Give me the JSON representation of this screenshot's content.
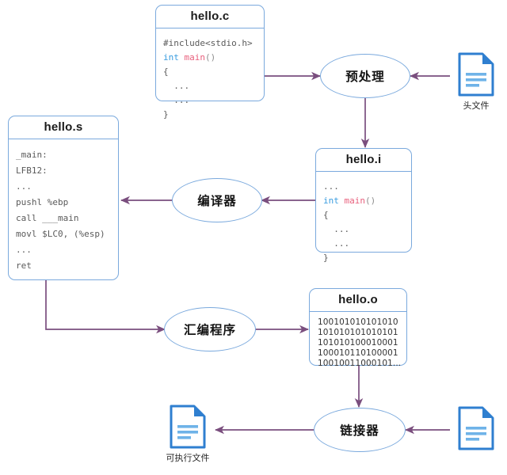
{
  "diagram": {
    "title": "C compilation pipeline",
    "colors": {
      "box_border": "#7aa9dd",
      "arrow": "#7a4e7e",
      "icon_blue": "#2f7fd0",
      "keyword_blue": "#3a9de0",
      "keyword_red": "#e8607d",
      "background": "#ffffff"
    },
    "files": {
      "hello_c": {
        "title": "hello.c",
        "lines": [
          "#include<stdio.h>",
          "int main()",
          "{",
          "  ...",
          "  ...",
          "}"
        ]
      },
      "hello_i": {
        "title": "hello.i",
        "lines": [
          "...",
          "int main()",
          "{",
          "  ...",
          "  ...",
          "}"
        ]
      },
      "hello_s": {
        "title": "hello.s",
        "lines": [
          "_main:",
          "LFB12:",
          "...",
          "pushl %ebp",
          "call ___main",
          "movl $LC0, (%esp)",
          "...",
          "ret"
        ]
      },
      "hello_o": {
        "title": "hello.o",
        "lines": [
          "100101010101010",
          "101010101010101",
          "101010100010001",
          "100010110100001",
          "10010011000101..."
        ]
      }
    },
    "processes": {
      "preprocess": "预处理",
      "compiler": "编译器",
      "assembler": "汇编程序",
      "linker": "链接器"
    },
    "icons": {
      "header_file": {
        "label": "头文件",
        "icon": "document-icon"
      },
      "executable_file": {
        "label": "可执行文件",
        "icon": "document-icon"
      },
      "library_file": {
        "label": "",
        "icon": "document-icon"
      }
    }
  }
}
